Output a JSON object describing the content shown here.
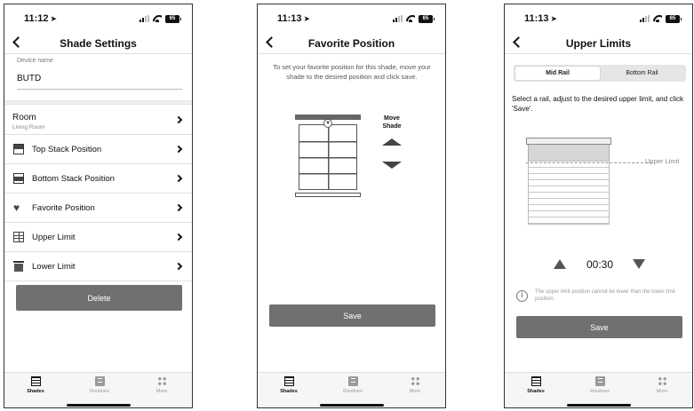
{
  "screens": [
    {
      "time": "11:12",
      "battery": "65",
      "title": "Shade Settings",
      "device_name_label": "Device name",
      "device_name_value": "BUTD",
      "room": {
        "label": "Room",
        "value": "Living Room"
      },
      "menu": [
        {
          "label": "Top Stack Position",
          "icon": "top-stack-icon"
        },
        {
          "label": "Bottom Stack Position",
          "icon": "bottom-stack-icon"
        },
        {
          "label": "Favorite Position",
          "icon": "heart-icon"
        },
        {
          "label": "Upper Limit",
          "icon": "grid-icon"
        },
        {
          "label": "Lower Limit",
          "icon": "lower-limit-icon"
        }
      ],
      "delete_label": "Delete"
    },
    {
      "time": "11:13",
      "battery": "65",
      "title": "Favorite Position",
      "instructions": "To set your favorite position for this shade, move your shade to the desired position and click save.",
      "move_label_1": "Move",
      "move_label_2": "Shade",
      "save_label": "Save"
    },
    {
      "time": "11:13",
      "battery": "65",
      "title": "Upper Limits",
      "rail_options": [
        "Mid Rail",
        "Bottom Rail"
      ],
      "rail_selected": "Mid Rail",
      "instructions": "Select a rail, adjust to the desired upper limit, and click 'Save'.",
      "limit_label": "Upper Limit",
      "time_value": "00:30",
      "info_text": "The upper limit position cannot be lower than the lower limit position.",
      "save_label": "Save"
    }
  ],
  "tabs": [
    {
      "label": "Shades",
      "icon": "shades-icon",
      "active": true
    },
    {
      "label": "Routines",
      "icon": "routines-icon",
      "active": false
    },
    {
      "label": "More",
      "icon": "more-icon",
      "active": false
    }
  ],
  "colors": {
    "button": "#707070",
    "accent": "#111111"
  }
}
